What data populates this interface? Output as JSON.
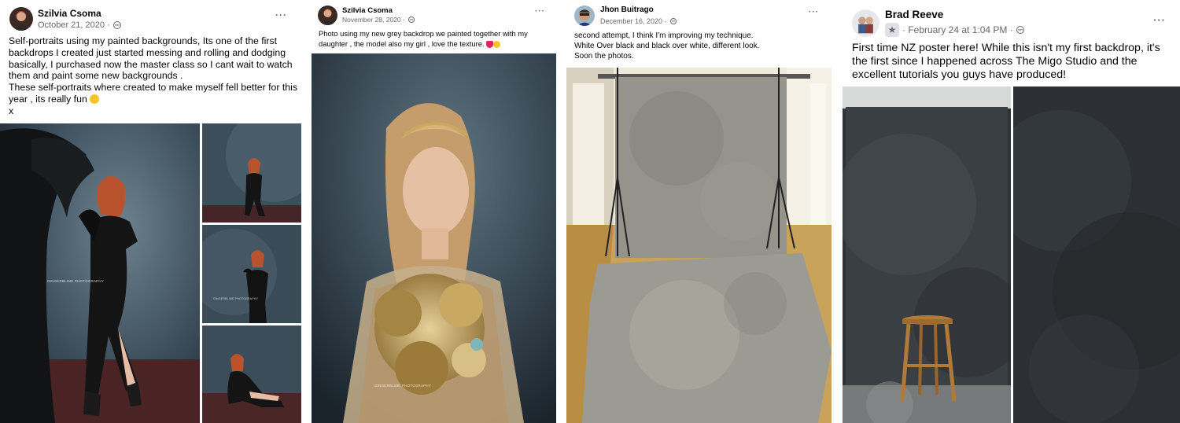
{
  "posts": [
    {
      "author": "Szilvia Csoma",
      "date": "October 21, 2020 ·",
      "caption": "Self-portraits using my painted backgrounds, Its one of the first backdrops I created just started messing and rolling and dodging basically, I purchased now the master class so I cant wait to watch them and paint some new backgrounds .\nThese self-portraits where created to make myself fell better for this year , its really fun",
      "caption_end": "x",
      "emoji": "smiling-face",
      "watermark": "GINGERBLIME PHOTOGRAPHY",
      "images": [
        "woman-black-dress-fabric-portrait",
        "woman-standing-portrait",
        "woman-seated-portrait",
        "woman-floor-pose-portrait"
      ]
    },
    {
      "author": "Szilvia Csoma",
      "date": "November 28, 2020 ·",
      "caption": "Photo using my new grey backdrop we painted together with my daughter , the model also my girl , love the texture.",
      "emoji": [
        "red-heart",
        "smiling-face"
      ],
      "watermark": "GINGERBLIME PHOTOGRAPHY",
      "images": [
        "girl-with-golden-flower-bouquet"
      ]
    },
    {
      "author": "Jhon Buitrago",
      "date": "December 16, 2020 ·",
      "caption": "second attempt, I think I'm improving my technique.\nWhite Over black and black over white, different look.\nSoon the photos.",
      "images": [
        "grey-painted-backdrop-on-stand-and-floor-cloth"
      ]
    },
    {
      "author": "Brad Reeve",
      "badge_icon": "star-badge-icon",
      "date": "· February 24 at 1:04 PM ·",
      "caption": "First time NZ poster here! While this isn't my first backdrop, it's the first since I happened across The Migo Studio and the excellent tutorials you guys have produced!",
      "images": [
        "dark-backdrop-with-wooden-stool",
        "dark-backdrop-closeup"
      ]
    }
  ],
  "more_label": "···",
  "colors": {
    "text": "#050505",
    "meta": "#65676b",
    "backdrop_teal": "#3c4d5a",
    "backdrop_grey": "#8c8c86",
    "floor_wood": "#c9a35a"
  }
}
